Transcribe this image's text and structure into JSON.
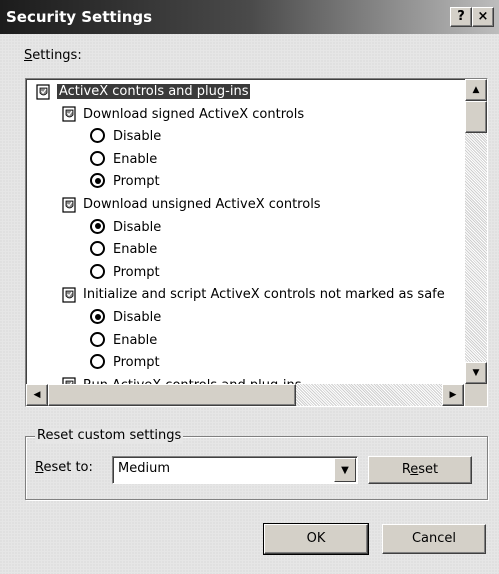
{
  "window": {
    "title": "Security Settings",
    "help_glyph": "?",
    "close_glyph": "×"
  },
  "settings_label": {
    "accel": "S",
    "rest": "ettings:"
  },
  "tree": [
    {
      "kind": "category",
      "label": "ActiveX controls and plug-ins",
      "selected": true
    },
    {
      "kind": "setting",
      "label": "Download signed ActiveX controls"
    },
    {
      "kind": "option",
      "label": "Disable",
      "checked": false
    },
    {
      "kind": "option",
      "label": "Enable",
      "checked": false
    },
    {
      "kind": "option",
      "label": "Prompt",
      "checked": true
    },
    {
      "kind": "setting",
      "label": "Download unsigned ActiveX controls"
    },
    {
      "kind": "option",
      "label": "Disable",
      "checked": true
    },
    {
      "kind": "option",
      "label": "Enable",
      "checked": false
    },
    {
      "kind": "option",
      "label": "Prompt",
      "checked": false
    },
    {
      "kind": "setting",
      "label": "Initialize and script ActiveX controls not marked as safe"
    },
    {
      "kind": "option",
      "label": "Disable",
      "checked": true
    },
    {
      "kind": "option",
      "label": "Enable",
      "checked": false
    },
    {
      "kind": "option",
      "label": "Prompt",
      "checked": false
    },
    {
      "kind": "setting",
      "label": "Run ActiveX controls and plug-ins"
    }
  ],
  "reset_group": {
    "legend": "Reset custom settings",
    "reset_to_accel": "R",
    "reset_to_rest": "eset to:",
    "selected_level": "Medium",
    "reset_button_pre": "R",
    "reset_button_accel": "e",
    "reset_button_post": "set"
  },
  "buttons": {
    "ok": "OK",
    "cancel": "Cancel"
  }
}
